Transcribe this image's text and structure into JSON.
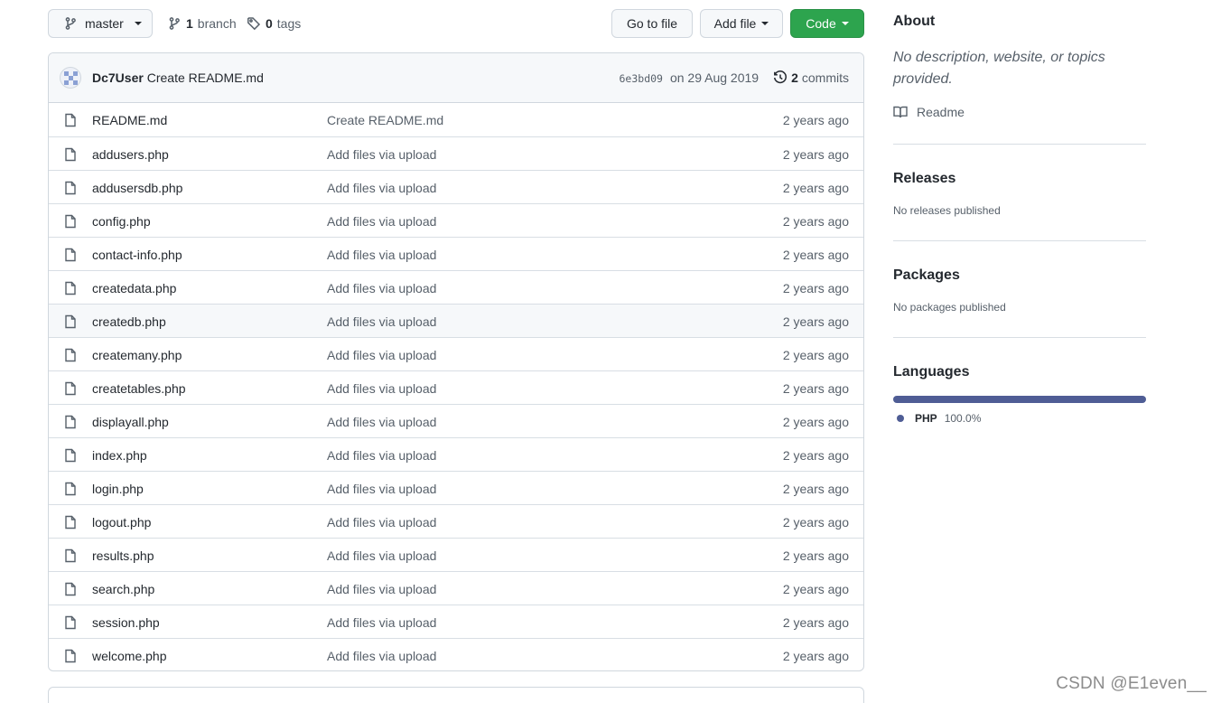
{
  "toolbar": {
    "branch_name": "master",
    "branches_count": "1",
    "branches_label": "branch",
    "tags_count": "0",
    "tags_label": "tags",
    "go_to_file_label": "Go to file",
    "add_file_label": "Add file",
    "code_label": "Code"
  },
  "latest_commit": {
    "author": "Dc7User",
    "message": "Create README.md",
    "sha": "6e3bd09",
    "date": "on 29 Aug 2019",
    "commits_count": "2",
    "commits_label": "commits"
  },
  "files": [
    {
      "name": "README.md",
      "message": "Create README.md",
      "age": "2 years ago"
    },
    {
      "name": "addusers.php",
      "message": "Add files via upload",
      "age": "2 years ago"
    },
    {
      "name": "addusersdb.php",
      "message": "Add files via upload",
      "age": "2 years ago"
    },
    {
      "name": "config.php",
      "message": "Add files via upload",
      "age": "2 years ago"
    },
    {
      "name": "contact-info.php",
      "message": "Add files via upload",
      "age": "2 years ago"
    },
    {
      "name": "createdata.php",
      "message": "Add files via upload",
      "age": "2 years ago"
    },
    {
      "name": "createdb.php",
      "message": "Add files via upload",
      "age": "2 years ago"
    },
    {
      "name": "createmany.php",
      "message": "Add files via upload",
      "age": "2 years ago"
    },
    {
      "name": "createtables.php",
      "message": "Add files via upload",
      "age": "2 years ago"
    },
    {
      "name": "displayall.php",
      "message": "Add files via upload",
      "age": "2 years ago"
    },
    {
      "name": "index.php",
      "message": "Add files via upload",
      "age": "2 years ago"
    },
    {
      "name": "login.php",
      "message": "Add files via upload",
      "age": "2 years ago"
    },
    {
      "name": "logout.php",
      "message": "Add files via upload",
      "age": "2 years ago"
    },
    {
      "name": "results.php",
      "message": "Add files via upload",
      "age": "2 years ago"
    },
    {
      "name": "search.php",
      "message": "Add files via upload",
      "age": "2 years ago"
    },
    {
      "name": "session.php",
      "message": "Add files via upload",
      "age": "2 years ago"
    },
    {
      "name": "welcome.php",
      "message": "Add files via upload",
      "age": "2 years ago"
    }
  ],
  "sidebar": {
    "about_heading": "About",
    "about_description": "No description, website, or topics provided.",
    "readme_label": "Readme",
    "releases_heading": "Releases",
    "releases_text": "No releases published",
    "packages_heading": "Packages",
    "packages_text": "No packages published",
    "languages_heading": "Languages",
    "language_name": "PHP",
    "language_percent": "100.0%",
    "language_color": "#4f5d95"
  },
  "colors": {
    "code_button": "#2da44e",
    "border": "#d0d7de",
    "muted_text": "#57606a"
  },
  "watermark": "CSDN @E1even__"
}
